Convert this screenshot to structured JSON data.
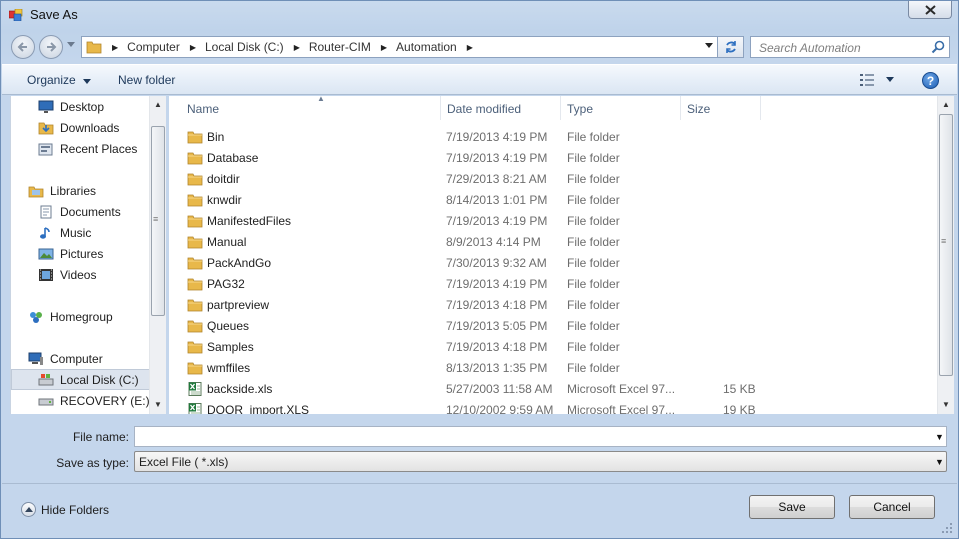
{
  "window": {
    "title": "Save As"
  },
  "address": {
    "crumbs": [
      "Computer",
      "Local Disk (C:)",
      "Router-CIM",
      "Automation"
    ]
  },
  "search": {
    "placeholder": "Search Automation"
  },
  "toolbar": {
    "organize_label": "Organize",
    "new_folder_label": "New folder",
    "help_label": "?"
  },
  "nav": {
    "items": [
      {
        "label": "Desktop",
        "icon": "desktop-icon"
      },
      {
        "label": "Downloads",
        "icon": "downloads-icon"
      },
      {
        "label": "Recent Places",
        "icon": "recent-places-icon"
      },
      {
        "label": "Libraries",
        "icon": "libraries-icon"
      },
      {
        "label": "Documents",
        "icon": "documents-icon"
      },
      {
        "label": "Music",
        "icon": "music-icon"
      },
      {
        "label": "Pictures",
        "icon": "pictures-icon"
      },
      {
        "label": "Videos",
        "icon": "videos-icon"
      },
      {
        "label": "Homegroup",
        "icon": "homegroup-icon"
      },
      {
        "label": "Computer",
        "icon": "computer-icon"
      },
      {
        "label": "Local Disk (C:)",
        "icon": "local-disk-icon",
        "selected": true
      },
      {
        "label": "RECOVERY (E:)",
        "icon": "recovery-drive-icon"
      }
    ]
  },
  "files": {
    "columns": [
      "Name",
      "Date modified",
      "Type",
      "Size"
    ],
    "rows": [
      {
        "name": "Bin",
        "date": "7/19/2013 4:19 PM",
        "type": "File folder",
        "size": "",
        "icon": "folder-icon"
      },
      {
        "name": "Database",
        "date": "7/19/2013 4:19 PM",
        "type": "File folder",
        "size": "",
        "icon": "folder-icon"
      },
      {
        "name": "doitdir",
        "date": "7/29/2013 8:21 AM",
        "type": "File folder",
        "size": "",
        "icon": "folder-icon"
      },
      {
        "name": "knwdir",
        "date": "8/14/2013 1:01 PM",
        "type": "File folder",
        "size": "",
        "icon": "folder-icon"
      },
      {
        "name": "ManifestedFiles",
        "date": "7/19/2013 4:19 PM",
        "type": "File folder",
        "size": "",
        "icon": "folder-icon"
      },
      {
        "name": "Manual",
        "date": "8/9/2013 4:14 PM",
        "type": "File folder",
        "size": "",
        "icon": "folder-icon"
      },
      {
        "name": "PackAndGo",
        "date": "7/30/2013 9:32 AM",
        "type": "File folder",
        "size": "",
        "icon": "folder-icon"
      },
      {
        "name": "PAG32",
        "date": "7/19/2013 4:19 PM",
        "type": "File folder",
        "size": "",
        "icon": "folder-icon"
      },
      {
        "name": "partpreview",
        "date": "7/19/2013 4:18 PM",
        "type": "File folder",
        "size": "",
        "icon": "folder-icon"
      },
      {
        "name": "Queues",
        "date": "7/19/2013 5:05 PM",
        "type": "File folder",
        "size": "",
        "icon": "folder-icon"
      },
      {
        "name": "Samples",
        "date": "7/19/2013 4:18 PM",
        "type": "File folder",
        "size": "",
        "icon": "folder-icon"
      },
      {
        "name": "wmffiles",
        "date": "8/13/2013 1:35 PM",
        "type": "File folder",
        "size": "",
        "icon": "folder-icon"
      },
      {
        "name": "backside.xls",
        "date": "5/27/2003 11:58 AM",
        "type": "Microsoft Excel 97...",
        "size": "15 KB",
        "icon": "excel-file-icon"
      },
      {
        "name": "DOOR_import.XLS",
        "date": "12/10/2002 9:59 AM",
        "type": "Microsoft Excel 97...",
        "size": "19 KB",
        "icon": "excel-file-icon"
      }
    ]
  },
  "form": {
    "file_name_label": "File name:",
    "file_name_value": "",
    "save_type_label": "Save as type:",
    "save_type_value": "Excel File  ( *.xls)"
  },
  "footer": {
    "hide_folders_label": "Hide Folders",
    "save_label": "Save",
    "cancel_label": "Cancel"
  },
  "colors": {
    "frame": "#bfd3ea",
    "toolbar_text": "#1e395b",
    "folder": "#e8b84a",
    "excel": "#1f7a3c"
  }
}
